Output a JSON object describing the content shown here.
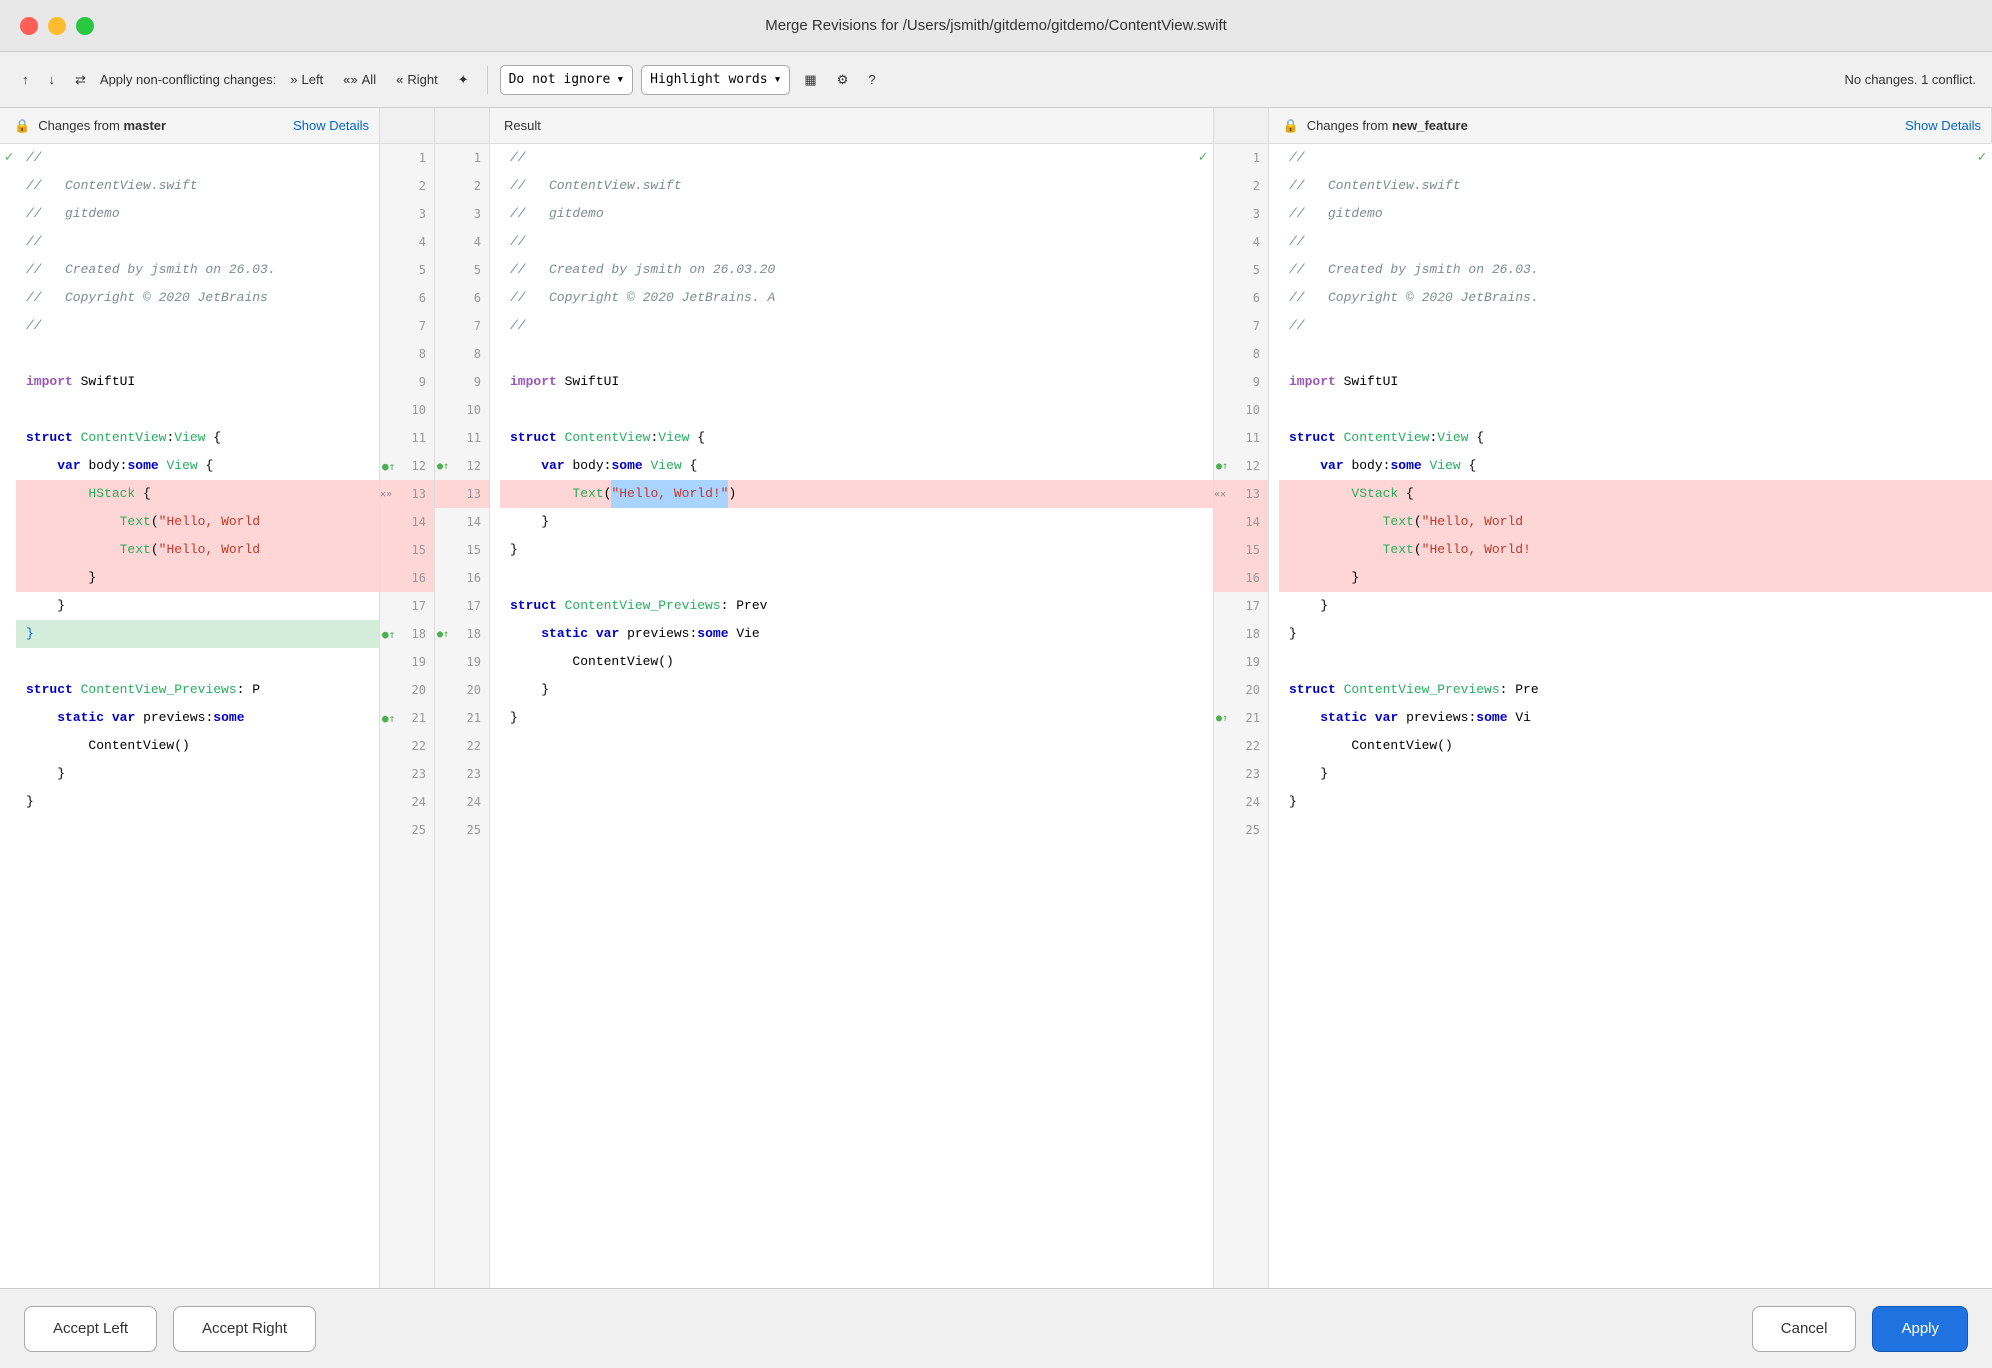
{
  "window": {
    "title": "Merge Revisions for /Users/jsmith/gitdemo/gitdemo/ContentView.swift"
  },
  "toolbar": {
    "apply_non_conflicting": "Apply non-conflicting changes:",
    "left_label": "Left",
    "all_label": "All",
    "right_label": "Right",
    "ignore_dropdown": "Do not ignore",
    "highlight_words": "Highlight words",
    "status": "No changes. 1 conflict."
  },
  "panels": {
    "left_header": "Changes from",
    "left_branch": "master",
    "left_show_details": "Show Details",
    "result_header": "Result",
    "right_header": "Changes from",
    "right_branch": "new_feature",
    "right_show_details": "Show Details"
  },
  "buttons": {
    "accept_left": "Accept Left",
    "accept_right": "Accept Right",
    "cancel": "Cancel",
    "apply": "Apply"
  },
  "code": {
    "lines": 25,
    "left": [
      "//",
      "//   ContentView.swift",
      "//   gitdemo",
      "//",
      "//   Created by jsmith on 26.03.",
      "//   Copyright © 2020 JetBrains",
      "//",
      "",
      "import SwiftUI",
      "",
      "struct ContentView: View {",
      "    var body: some View {",
      "        HStack {",
      "            Text(\"Hello, World",
      "            Text(\"Hello, World",
      "        }",
      "    }",
      "}",
      "",
      "struct ContentView_Previews: P",
      "    static var previews: some",
      "        ContentView()",
      "    }",
      "}",
      ""
    ],
    "result": [
      "//",
      "//   ContentView.swift",
      "//   gitdemo",
      "//",
      "//   Created by jsmith on 26.03.20",
      "//   Copyright © 2020 JetBrains. A",
      "//",
      "",
      "import SwiftUI",
      "",
      "struct ContentView: View {",
      "    var body: some View {",
      "        Text(\"Hello, World!\")",
      "    }",
      "}",
      "",
      "struct ContentView_Previews: Prev",
      "    static var previews: some Vie",
      "        ContentView()",
      "    }",
      "}",
      "",
      "",
      "",
      ""
    ],
    "right": [
      "//",
      "//   ContentView.swift",
      "//   gitdemo",
      "//",
      "//   Created by jsmith on 26.03.",
      "//   Copyright © 2020 JetBrains.",
      "//",
      "",
      "import SwiftUI",
      "",
      "struct ContentView: View {",
      "    var body: some View {",
      "        VStack {",
      "            Text(\"Hello, World",
      "            Text(\"Hello, World!",
      "        }",
      "    }",
      "}",
      "",
      "struct ContentView_Previews: Pre",
      "    static var previews: some Vi",
      "        ContentView()",
      "    }",
      "}",
      ""
    ]
  }
}
